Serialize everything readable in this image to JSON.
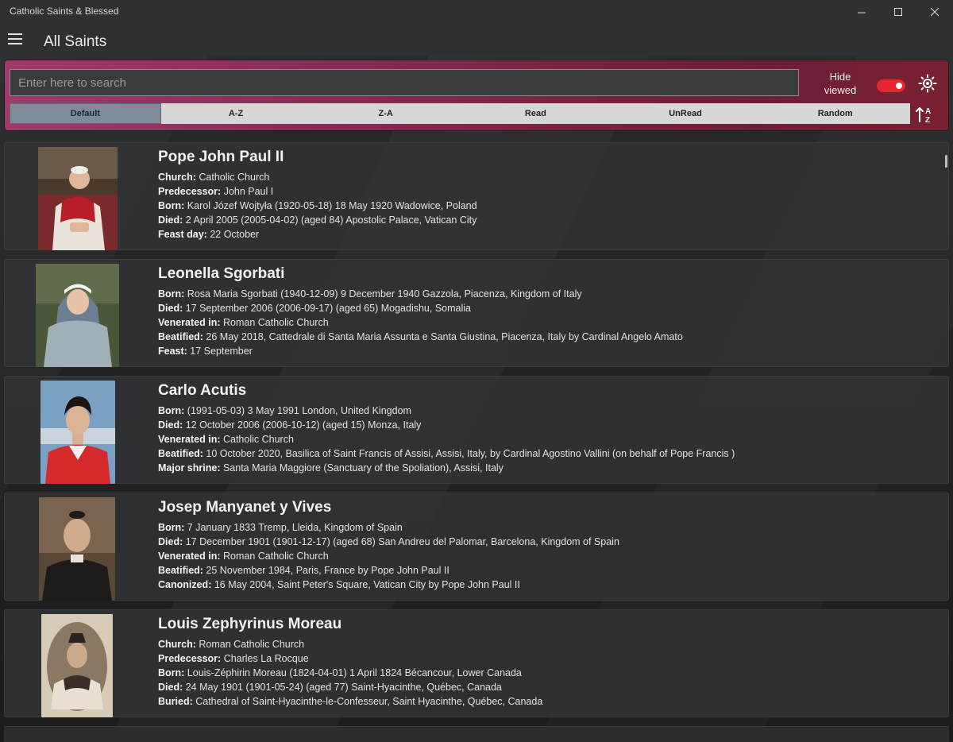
{
  "window": {
    "title": "Catholic Saints & Blessed",
    "minimize": "—",
    "maximize": "☐",
    "close": "✕"
  },
  "header": {
    "title": "All Saints",
    "menu_icon": "hamburger-menu-icon"
  },
  "toolbar": {
    "search_placeholder": "Enter here to search",
    "search_value": "",
    "hide_viewed_label_line1": "Hide",
    "hide_viewed_label_line2": "viewed",
    "hide_viewed_on": true,
    "toggle_color": "#e8262f",
    "theme_icon": "sun-icon",
    "sort_icon": "sort-az-icon",
    "sort_options": [
      "Default",
      "A-Z",
      "Z-A",
      "Read",
      "UnRead",
      "Random"
    ],
    "sort_selected": "Default"
  },
  "saints": [
    {
      "name": "Pope John Paul II",
      "details": [
        {
          "label": "Church:",
          "value": " Catholic Church"
        },
        {
          "label": "Predecessor:",
          "value": " John Paul I"
        },
        {
          "label": "Born:",
          "value": " Karol Józef Wojtyła (1920-05-18) 18 May 1920 Wadowice, Poland"
        },
        {
          "label": "Died:",
          "value": " 2 April 2005 (2005-04-02) (aged 84) Apostolic Palace, Vatican City"
        },
        {
          "label": "Feast day:",
          "value": " 22 October"
        }
      ]
    },
    {
      "name": "Leonella Sgorbati",
      "details": [
        {
          "label": "Born:",
          "value": " Rosa Maria Sgorbati (1940-12-09) 9 December 1940 Gazzola, Piacenza, Kingdom of Italy"
        },
        {
          "label": "Died:",
          "value": " 17 September 2006 (2006-09-17) (aged 65) Mogadishu, Somalia"
        },
        {
          "label": "Venerated in:",
          "value": " Roman Catholic Church"
        },
        {
          "label": "Beatified:",
          "value": " 26 May 2018, Cattedrale di Santa Maria Assunta e Santa Giustina, Piacenza, Italy by Cardinal Angelo Amato"
        },
        {
          "label": "Feast:",
          "value": " 17 September"
        }
      ]
    },
    {
      "name": "Carlo Acutis",
      "details": [
        {
          "label": "Born:",
          "value": " (1991-05-03) 3 May 1991 London, United Kingdom"
        },
        {
          "label": "Died:",
          "value": " 12 October 2006 (2006-10-12) (aged 15) Monza, Italy"
        },
        {
          "label": "Venerated in:",
          "value": " Catholic Church"
        },
        {
          "label": "Beatified:",
          "value": " 10 October 2020, Basilica of Saint Francis of Assisi, Assisi, Italy, by Cardinal Agostino Vallini (on behalf of Pope Francis )"
        },
        {
          "label": "Major shrine:",
          "value": " Santa Maria Maggiore (Sanctuary of the Spoliation), Assisi, Italy"
        }
      ]
    },
    {
      "name": "Josep Manyanet y Vives",
      "details": [
        {
          "label": "Born:",
          "value": " 7 January 1833 Tremp, Lleida, Kingdom of Spain"
        },
        {
          "label": "Died:",
          "value": " 17 December 1901 (1901-12-17) (aged 68) San Andreu del Palomar, Barcelona, Kingdom of Spain"
        },
        {
          "label": "Venerated in:",
          "value": " Roman Catholic Church"
        },
        {
          "label": "Beatified:",
          "value": " 25 November 1984, Paris, France by Pope John Paul II"
        },
        {
          "label": "Canonized:",
          "value": " 16 May 2004, Saint Peter's Square, Vatican City by Pope John Paul II"
        }
      ]
    },
    {
      "name": "Louis Zephyrinus Moreau",
      "details": [
        {
          "label": "Church:",
          "value": " Roman Catholic Church"
        },
        {
          "label": "Predecessor:",
          "value": " Charles La Rocque"
        },
        {
          "label": "Born:",
          "value": " Louis-Zéphirin Moreau (1824-04-01) 1 April 1824 Bécancour, Lower Canada"
        },
        {
          "label": "Died:",
          "value": " 24 May 1901 (1901-05-24) (aged 77) Saint-Hyacinthe, Québec, Canada"
        },
        {
          "label": "Buried:",
          "value": " Cathedral of Saint-Hyacinthe-le-Confesseur, Saint Hyacinthe, Québec, Canada"
        }
      ]
    }
  ]
}
